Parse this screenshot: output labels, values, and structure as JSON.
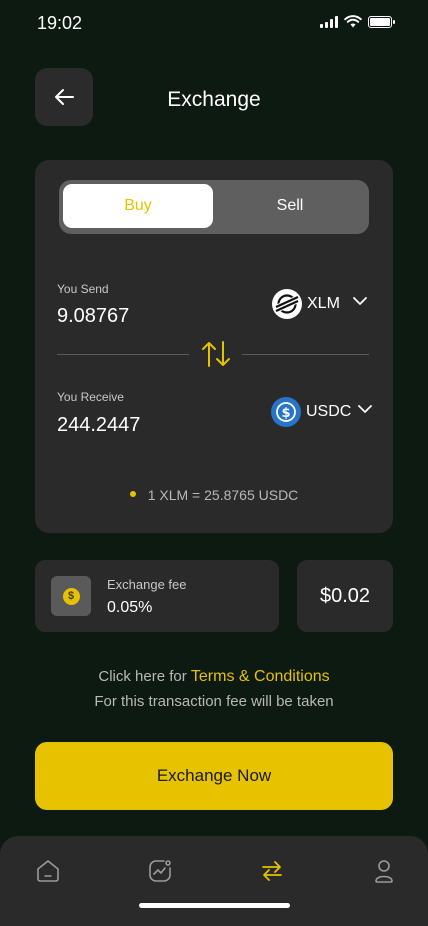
{
  "status_bar": {
    "time": "19:02"
  },
  "header": {
    "title": "Exchange"
  },
  "toggle": {
    "buy_label": "Buy",
    "sell_label": "Sell",
    "selected": "Buy"
  },
  "send": {
    "label": "You Send",
    "amount": "9.08767",
    "token": "XLM"
  },
  "receive": {
    "label": "You Receive",
    "amount": "244.2447",
    "token": "USDC"
  },
  "rate": {
    "text": "1 XLM = 25.8765 USDC"
  },
  "fee": {
    "label": "Exchange fee",
    "percent": "0.05%",
    "amount": "$0.02"
  },
  "terms": {
    "prefix": "Click here for",
    "link_text": "Terms & Conditions",
    "subtext": "For this transaction fee will be taken"
  },
  "action": {
    "button_label": "Exchange Now"
  },
  "tabs": [
    {
      "icon": "home-icon",
      "active": false
    },
    {
      "icon": "chart-icon",
      "active": false
    },
    {
      "icon": "exchange-icon",
      "active": true
    },
    {
      "icon": "profile-icon",
      "active": false
    }
  ],
  "colors": {
    "accent": "#e6c200",
    "background": "#0c1a12",
    "card": "#2a2a2a"
  }
}
